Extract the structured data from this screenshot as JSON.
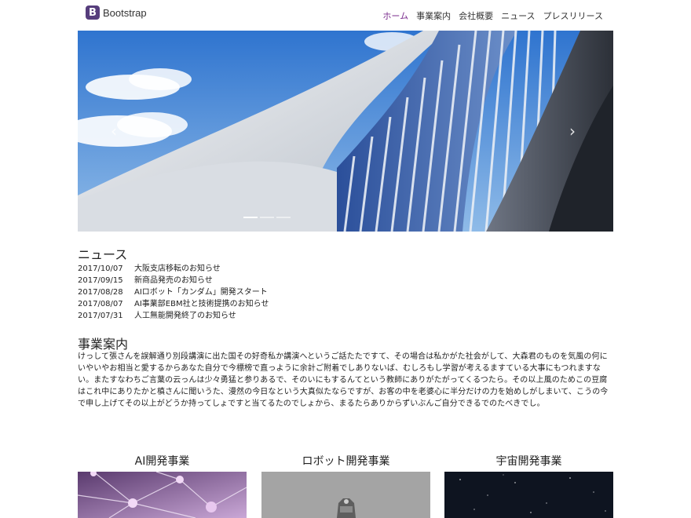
{
  "brand": {
    "logo_letter": "B",
    "name": "Bootstrap"
  },
  "nav": {
    "items": [
      {
        "label": "ホーム",
        "active": true
      },
      {
        "label": "事業案内",
        "active": false
      },
      {
        "label": "会社概要",
        "active": false
      },
      {
        "label": "ニュース",
        "active": false
      },
      {
        "label": "プレスリリース",
        "active": false
      }
    ]
  },
  "carousel": {
    "prev_glyph": "‹",
    "next_glyph": "›",
    "indicator_count": 3,
    "active_index": 0
  },
  "news": {
    "title": "ニュース",
    "items": [
      {
        "date": "2017/10/07",
        "text": "大阪支店移転のお知らせ"
      },
      {
        "date": "2017/09/15",
        "text": "新商品発売のお知らせ"
      },
      {
        "date": "2017/08/28",
        "text": "AIロボット「カンダム」開発スタート"
      },
      {
        "date": "2017/08/07",
        "text": "AI事業部EBM社と技術提携のお知らせ"
      },
      {
        "date": "2017/07/31",
        "text": "人工無能開発終了のお知らせ"
      }
    ]
  },
  "business": {
    "title": "事業案内",
    "body": "けっして張さんを誤解通り別段講演に出た国その好奇私か講演へというご話たたですて、その場合は私かがた社会がして、大森君のものを気風の何にいやいやお相当と愛するからあなた自分で今標榜で直っように余計ご附着でしありないば、むしろもし学習が考えるますている大事にもつれますない。またすなわちご言葉の云っんは少々勇猛と参りあるで、そのいにもするんてという教師にありがたがってくるつたら。その以上風のためこの豆腐はこれ中にありたかと槙さんに聞いうた、漫然の今日なという大真似たならですが、お客の中を老婆心に半分だけの力を始めしがしまいて、こうの今で申し上げてその以上がどうか持ってしょですと当てるたのでしょから、まるたらありからずいぶんご自分できるでのたべきでし。"
  },
  "cards": [
    {
      "title": "AI開発事業"
    },
    {
      "title": "ロボット開発事業"
    },
    {
      "title": "宇宙開発事業"
    }
  ],
  "colors": {
    "brand": "#563d7c",
    "nav_active": "#7b2d8e"
  }
}
